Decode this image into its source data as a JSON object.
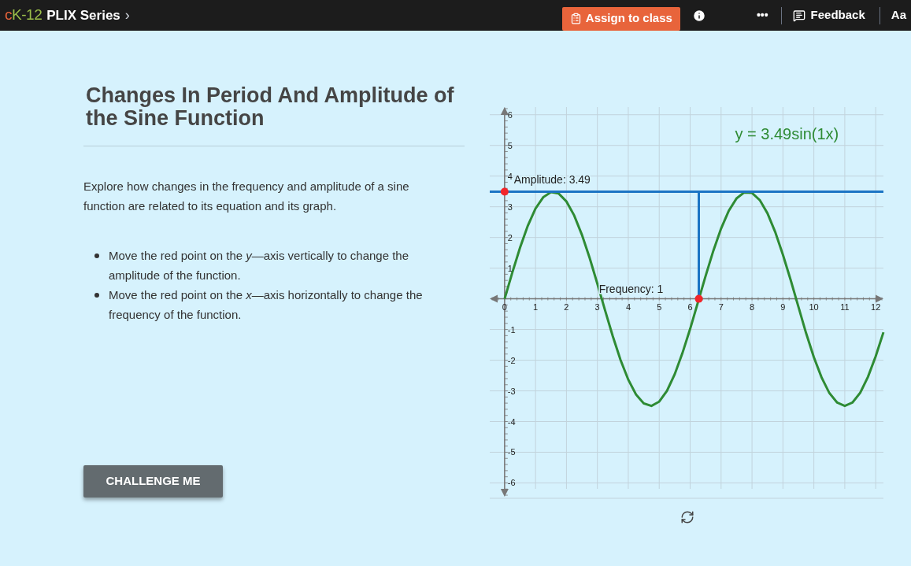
{
  "top_bar": {
    "logo": {
      "prefix": "c",
      "rest": "K-12"
    },
    "breadcrumb": "PLIX Series",
    "breadcrumb_arrow": "›",
    "assign_button": "Assign to class",
    "more": "•••",
    "feedback": "Feedback",
    "font_button": "Aa"
  },
  "lesson": {
    "title": "Changes In Period And Amplitude of the Sine Function",
    "intro": "Explore how changes in the frequency and amplitude of a sine function are related to its equation and its graph.",
    "instructions": [
      "Move the red point on the *y*—axis vertically to change the amplitude of the function.",
      "Move the red point on the *x*—axis horizontally to change the frequency of the function."
    ],
    "challenge_button": "CHALLENGE ME"
  },
  "graph": {
    "chart_data": {
      "type": "line",
      "xlim": [
        -0.48,
        12.25
      ],
      "ylim": [
        -6.45,
        6.25
      ],
      "grid": true,
      "xticks": [
        {
          "value": 0,
          "label": "0"
        },
        {
          "value": 1,
          "label": "1"
        },
        {
          "value": 2,
          "label": "2"
        },
        {
          "value": 3,
          "label": "3"
        },
        {
          "value": 4,
          "label": "4"
        },
        {
          "value": 5,
          "label": "5"
        },
        {
          "value": 6,
          "label": "6"
        },
        {
          "value": 7,
          "label": "7"
        },
        {
          "value": 8,
          "label": "8"
        },
        {
          "value": 9,
          "label": "9"
        },
        {
          "value": 10,
          "label": "10"
        },
        {
          "value": 11,
          "label": "11"
        },
        {
          "value": 12,
          "label": "12"
        }
      ],
      "yticks": [
        {
          "value": -6,
          "label": "-6"
        },
        {
          "value": -5,
          "label": "-5"
        },
        {
          "value": -4,
          "label": "-4"
        },
        {
          "value": -3,
          "label": "-3"
        },
        {
          "value": -2,
          "label": "-2"
        },
        {
          "value": -1,
          "label": "-1"
        },
        {
          "value": 1,
          "label": "1"
        },
        {
          "value": 2,
          "label": "2"
        },
        {
          "value": 3,
          "label": "3"
        },
        {
          "value": 4,
          "label": "4"
        },
        {
          "value": 5,
          "label": "5"
        },
        {
          "value": 6,
          "label": "6"
        }
      ],
      "x": [
        0,
        0.25,
        0.5,
        0.75,
        1,
        1.25,
        1.5,
        1.75,
        2,
        2.25,
        2.5,
        2.75,
        3,
        3.25,
        3.5,
        3.75,
        4,
        4.25,
        4.5,
        4.75,
        5,
        5.25,
        5.5,
        5.75,
        6,
        6.25,
        6.5,
        6.75,
        7,
        7.25,
        7.5,
        7.75,
        8,
        8.25,
        8.5,
        8.75,
        9,
        9.25,
        9.5,
        9.75,
        10,
        10.25,
        10.5,
        10.75,
        11,
        11.25,
        11.5,
        11.75,
        12,
        12.25
      ],
      "series": [
        {
          "name": "y = 3.49sin(1x)",
          "color": "#2e8b34",
          "values": [
            0,
            0.86,
            1.67,
            2.38,
            2.94,
            3.31,
            3.48,
            3.43,
            3.17,
            2.72,
            2.09,
            1.33,
            0.49,
            -0.38,
            -1.22,
            -1.99,
            -2.64,
            -3.12,
            -3.41,
            -3.49,
            -3.35,
            -3,
            -2.46,
            -1.77,
            -0.98,
            -0.12,
            0.75,
            1.57,
            2.29,
            2.87,
            3.27,
            3.47,
            3.45,
            3.22,
            2.79,
            2.18,
            1.44,
            0.61,
            -0.26,
            -1.12,
            -1.9,
            -2.56,
            -3.07,
            -3.38,
            -3.49,
            -3.38,
            -3.06,
            -2.54,
            -1.87,
            -1.09
          ]
        }
      ],
      "ref_lines": [
        {
          "axis": "y",
          "value": 3.49
        },
        {
          "axis": "x",
          "value": 6.28
        }
      ],
      "annotations": [
        "Amplitude: 3.49",
        "Frequency: 1"
      ]
    }
  }
}
